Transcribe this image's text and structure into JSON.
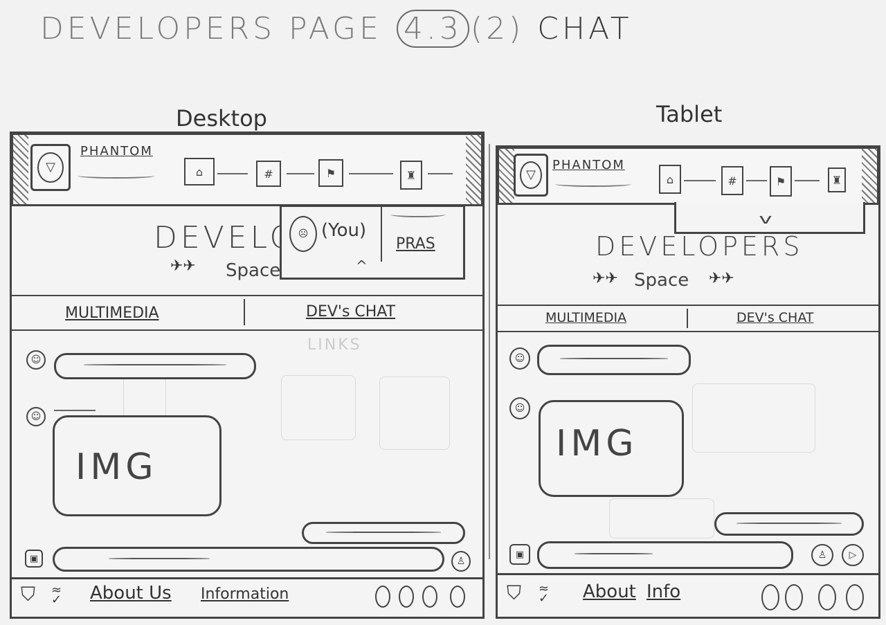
{
  "title": {
    "prefix": "DEVELOPERS PAGE",
    "number": "4.3",
    "sub": "(2)",
    "chat": "CHAT"
  },
  "labels": {
    "desktop": "Desktop",
    "tablet": "Tablet"
  },
  "desktop": {
    "brand": "PHANTOM",
    "hero_title": "DEVELO",
    "hero_sub": "Space",
    "dropdown_you": "(You)",
    "dropdown_name": "PRAS",
    "tabs": [
      "MULTIMEDIA",
      "DEV's CHAT"
    ],
    "ghost": "LINKS",
    "image_label": "IMG",
    "footer": {
      "about": "About Us",
      "info": "Information"
    }
  },
  "tablet": {
    "brand": "PHANTOM",
    "hero_title": "DEVELOPERS",
    "hero_sub": "Space",
    "tabs": [
      "MULTIMEDIA",
      "DEV's CHAT"
    ],
    "image_label": "IMG",
    "footer": {
      "about": "About",
      "info": "Info"
    }
  },
  "icons": [
    "shield-logo-icon",
    "home-icon",
    "grid-icon",
    "flag-icon",
    "trophy-icon",
    "user-icon",
    "satellite-icon",
    "attach-icon",
    "joystick-icon",
    "send-icon"
  ]
}
